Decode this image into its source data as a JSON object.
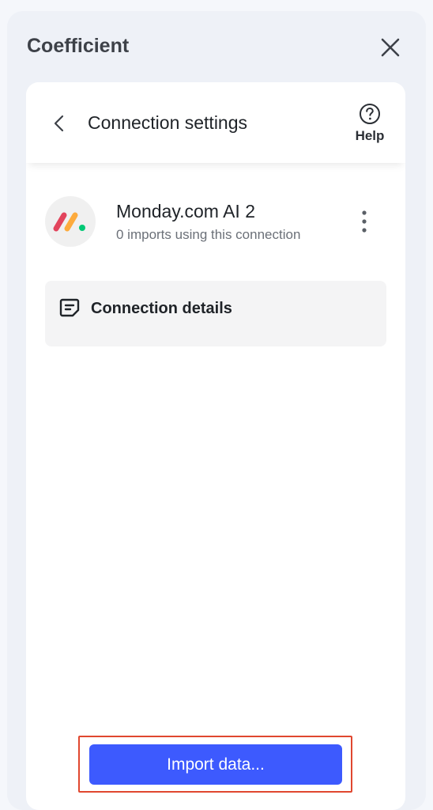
{
  "app": {
    "title": "Coefficient"
  },
  "header": {
    "title": "Connection settings",
    "help_label": "Help"
  },
  "connection": {
    "name": "Monday.com AI 2",
    "subtitle": "0 imports using this connection",
    "logo_colors": [
      "#e2445c",
      "#fdab3d",
      "#00c875"
    ]
  },
  "details": {
    "label": "Connection details"
  },
  "actions": {
    "import_label": "Import data..."
  },
  "colors": {
    "accent": "#3d5afe",
    "highlight": "#e0472f"
  },
  "icons": [
    "close-icon",
    "chevron-left-icon",
    "help-circle-icon",
    "monday-logo-icon",
    "more-vertical-icon",
    "note-icon"
  ]
}
